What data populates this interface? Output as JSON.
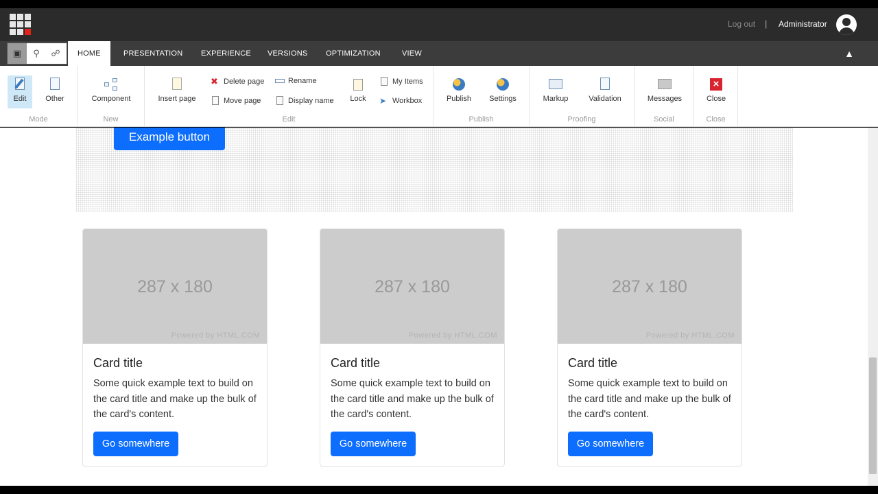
{
  "header": {
    "logout": "Log out",
    "separator": "|",
    "user": "Administrator"
  },
  "tabs": [
    "HOME",
    "PRESENTATION",
    "EXPERIENCE",
    "VERSIONS",
    "OPTIMIZATION",
    "VIEW"
  ],
  "ribbon": {
    "mode": {
      "label": "Mode",
      "edit": "Edit",
      "other": "Other"
    },
    "new": {
      "label": "New",
      "component": "Component"
    },
    "edit": {
      "label": "Edit",
      "insert_page": "Insert page",
      "delete_page": "Delete page",
      "move_page": "Move page",
      "rename": "Rename",
      "display_name": "Display name",
      "lock": "Lock",
      "my_items": "My Items",
      "workbox": "Workbox"
    },
    "publish": {
      "label": "Publish",
      "publish": "Publish",
      "settings": "Settings"
    },
    "proofing": {
      "label": "Proofing",
      "markup": "Markup",
      "validation": "Validation"
    },
    "social": {
      "label": "Social",
      "messages": "Messages"
    },
    "close": {
      "label": "Close",
      "close": "Close"
    }
  },
  "page": {
    "example_button": "Example button",
    "cards": [
      {
        "image_size": "287 x 180",
        "image_credit": "Powered by HTML.COM",
        "title": "Card title",
        "text": "Some quick example text to build on the card title and make up the bulk of the card's content.",
        "button": "Go somewhere"
      },
      {
        "image_size": "287 x 180",
        "image_credit": "Powered by HTML.COM",
        "title": "Card title",
        "text": "Some quick example text to build on the card title and make up the bulk of the card's content.",
        "button": "Go somewhere"
      },
      {
        "image_size": "287 x 180",
        "image_credit": "Powered by HTML.COM",
        "title": "Card title",
        "text": "Some quick example text to build on the card title and make up the bulk of the card's content.",
        "button": "Go somewhere"
      }
    ]
  },
  "colors": {
    "primary": "#0d6efd",
    "topbar": "#2b2b2b",
    "tabbar": "#3c3c3c",
    "brand_red": "#e2231a"
  }
}
